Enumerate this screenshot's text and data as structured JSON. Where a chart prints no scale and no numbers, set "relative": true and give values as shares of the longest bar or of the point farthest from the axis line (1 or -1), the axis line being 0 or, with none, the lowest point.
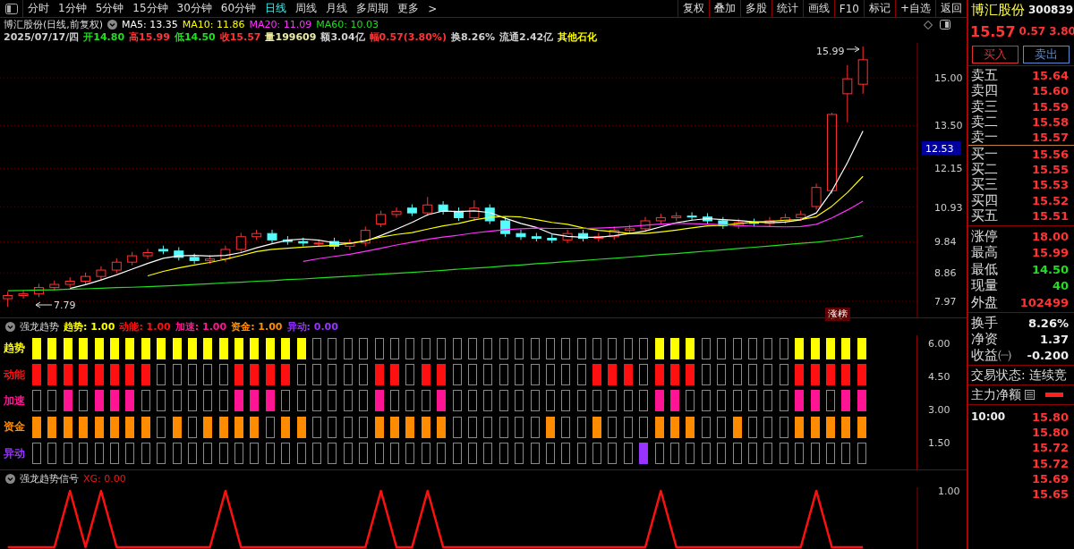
{
  "toolbar": {
    "tabs": [
      {
        "label": "分时",
        "selected": false
      },
      {
        "label": "1分钟",
        "selected": false
      },
      {
        "label": "5分钟",
        "selected": false
      },
      {
        "label": "15分钟",
        "selected": false
      },
      {
        "label": "30分钟",
        "selected": false
      },
      {
        "label": "60分钟",
        "selected": false
      },
      {
        "label": "日线",
        "selected": true
      },
      {
        "label": "周线",
        "selected": false
      },
      {
        "label": "月线",
        "selected": false
      },
      {
        "label": "多周期",
        "selected": false
      },
      {
        "label": "更多",
        "selected": false
      }
    ],
    "more_arrow": ">",
    "buttons": [
      "复权",
      "叠加",
      "多股",
      "统计",
      "画线",
      "F10",
      "标记",
      "+自选",
      "返回"
    ]
  },
  "chart_header": {
    "title": "博汇股份(日线,前复权)",
    "ma_readings": [
      ": 13.35",
      ": 11.86",
      ": 11.09",
      ": 10.03"
    ],
    "quote": [
      {
        "text": "2025/07/17/四",
        "color": "#d0d0d0"
      },
      {
        "text": "开14.80",
        "color": "#22dd22"
      },
      {
        "text": "高15.99",
        "color": "#ff3333"
      },
      {
        "text": "低14.50",
        "color": "#22dd22"
      },
      {
        "text": "收15.57",
        "color": "#ff3333"
      },
      {
        "text": "量199609",
        "color": "#e8e8a0"
      },
      {
        "text": "额3.04亿",
        "color": "#d0d0d0"
      },
      {
        "text": "幅0.57(3.80%)",
        "color": "#ff3333"
      },
      {
        "text": "换8.26%",
        "color": "#d0d0d0"
      },
      {
        "text": "流通2.42亿",
        "color": "#d0d0d0"
      },
      {
        "text": "其他石化",
        "color": "#ffff00"
      }
    ]
  },
  "main_chart": {
    "current_price": "12.53",
    "high_label": "15.99",
    "low_label": "7.79",
    "tag": "涨榜",
    "chart_data": {
      "type": "candlestick",
      "ylim": [
        7.46,
        16.1
      ],
      "grid": true,
      "ohlc": [
        [
          8.05,
          8.27,
          7.79,
          8.15
        ],
        [
          8.15,
          8.32,
          8.05,
          8.2
        ],
        [
          8.2,
          8.52,
          8.1,
          8.4
        ],
        [
          8.4,
          8.62,
          8.3,
          8.5
        ],
        [
          8.5,
          8.72,
          8.4,
          8.6
        ],
        [
          8.6,
          8.87,
          8.5,
          8.75
        ],
        [
          8.75,
          9.07,
          8.65,
          8.95
        ],
        [
          8.95,
          9.32,
          8.85,
          9.2
        ],
        [
          9.2,
          9.52,
          9.1,
          9.4
        ],
        [
          9.4,
          9.62,
          9.3,
          9.5
        ],
        [
          9.6,
          9.72,
          9.45,
          9.55
        ],
        [
          9.55,
          9.67,
          9.25,
          9.35
        ],
        [
          9.35,
          9.47,
          9.15,
          9.25
        ],
        [
          9.25,
          9.42,
          9.15,
          9.3
        ],
        [
          9.3,
          9.72,
          9.2,
          9.6
        ],
        [
          9.6,
          10.12,
          9.5,
          10.0
        ],
        [
          10.0,
          10.22,
          9.9,
          10.1
        ],
        [
          10.1,
          10.22,
          9.8,
          9.9
        ],
        [
          9.9,
          10.02,
          9.75,
          9.85
        ],
        [
          9.85,
          9.97,
          9.7,
          9.8
        ],
        [
          9.8,
          9.92,
          9.7,
          9.8
        ],
        [
          9.85,
          9.97,
          9.6,
          9.7
        ],
        [
          9.7,
          9.92,
          9.6,
          9.8
        ],
        [
          9.8,
          10.32,
          9.7,
          10.2
        ],
        [
          10.4,
          10.82,
          10.3,
          10.7
        ],
        [
          10.7,
          10.92,
          10.6,
          10.8
        ],
        [
          10.9,
          11.02,
          10.65,
          10.75
        ],
        [
          10.75,
          11.25,
          10.65,
          11.0
        ],
        [
          11.0,
          11.12,
          10.7,
          10.8
        ],
        [
          10.8,
          10.92,
          10.5,
          10.6
        ],
        [
          10.6,
          11.15,
          10.5,
          10.9
        ],
        [
          10.9,
          11.02,
          10.4,
          10.5
        ],
        [
          10.5,
          10.62,
          10.0,
          10.1
        ],
        [
          10.1,
          10.22,
          9.9,
          10.0
        ],
        [
          10.0,
          10.12,
          9.85,
          9.95
        ],
        [
          9.95,
          10.07,
          9.8,
          9.9
        ],
        [
          9.9,
          10.22,
          9.8,
          10.1
        ],
        [
          10.1,
          10.22,
          9.85,
          9.95
        ],
        [
          9.95,
          10.12,
          9.85,
          10.0
        ],
        [
          10.0,
          10.32,
          9.9,
          10.2
        ],
        [
          10.2,
          10.37,
          10.1,
          10.25
        ],
        [
          10.25,
          10.62,
          10.15,
          10.5
        ],
        [
          10.5,
          10.72,
          10.4,
          10.6
        ],
        [
          10.6,
          10.77,
          10.5,
          10.65
        ],
        [
          10.65,
          10.77,
          10.52,
          10.62
        ],
        [
          10.62,
          10.74,
          10.4,
          10.5
        ],
        [
          10.5,
          10.62,
          10.25,
          10.35
        ],
        [
          10.35,
          10.57,
          10.25,
          10.45
        ],
        [
          10.45,
          10.57,
          10.32,
          10.42
        ],
        [
          10.42,
          10.62,
          10.32,
          10.5
        ],
        [
          10.5,
          10.72,
          10.4,
          10.6
        ],
        [
          10.6,
          10.82,
          10.5,
          10.7
        ],
        [
          10.95,
          11.67,
          10.85,
          11.55
        ],
        [
          11.45,
          13.9,
          11.35,
          13.85
        ],
        [
          14.5,
          15.4,
          13.6,
          14.97
        ],
        [
          14.8,
          15.99,
          14.5,
          15.57
        ],
        null,
        null,
        null
      ],
      "categories": [
        null,
        null,
        null,
        null,
        null,
        null,
        null,
        null,
        null,
        null,
        null,
        null,
        null,
        null,
        null,
        null,
        null,
        null,
        null,
        null,
        null,
        null,
        null,
        null,
        null,
        null,
        null,
        null,
        null,
        null,
        null,
        null,
        null,
        null,
        null,
        null,
        null,
        null,
        null,
        null,
        null,
        null,
        null,
        null,
        null,
        null,
        null,
        null,
        null,
        null,
        null,
        null,
        null,
        null,
        null,
        null,
        null,
        null,
        null
      ],
      "yticks": [
        {
          "value": 15,
          "label": "15.00"
        },
        {
          "value": 13.5,
          "label": "13.50"
        },
        {
          "value": 12.15,
          "label": "12.15"
        },
        {
          "value": 10.93,
          "label": "10.93"
        },
        {
          "value": 9.84,
          "label": "9.84"
        },
        {
          "value": 8.86,
          "label": "8.86"
        },
        {
          "value": 7.97,
          "label": "7.97"
        }
      ],
      "series": [
        {
          "name": "MA5",
          "type": "line",
          "color": "#ffffff",
          "values": [
            null,
            null,
            null,
            null,
            8.37,
            8.49,
            8.64,
            8.8,
            8.98,
            9.16,
            9.32,
            9.4,
            9.41,
            9.39,
            9.41,
            9.5,
            9.65,
            9.78,
            9.89,
            9.93,
            9.89,
            9.81,
            9.79,
            9.86,
            10.04,
            10.24,
            10.45,
            10.69,
            10.81,
            10.79,
            10.81,
            10.76,
            10.58,
            10.42,
            10.29,
            10.09,
            10.01,
            9.98,
            9.98,
            10.03,
            10.1,
            10.18,
            10.31,
            10.44,
            10.52,
            10.57,
            10.54,
            10.51,
            10.47,
            10.44,
            10.46,
            10.53,
            10.75,
            11.44,
            12.33,
            13.33,
            null,
            null,
            null
          ]
        },
        {
          "name": "MA10",
          "type": "line",
          "color": "#ffff00",
          "values": [
            null,
            null,
            null,
            null,
            null,
            null,
            null,
            null,
            null,
            8.77,
            8.91,
            9.02,
            9.11,
            9.19,
            9.29,
            9.41,
            9.53,
            9.6,
            9.64,
            9.67,
            9.7,
            9.73,
            9.79,
            9.88,
            9.99,
            10.07,
            10.13,
            10.24,
            10.34,
            10.42,
            10.53,
            10.61,
            10.64,
            10.62,
            10.54,
            10.45,
            10.39,
            10.28,
            10.2,
            10.16,
            10.1,
            10.1,
            10.15,
            10.21,
            10.28,
            10.34,
            10.36,
            10.41,
            10.46,
            10.48,
            10.52,
            10.54,
            10.63,
            10.96,
            11.39,
            11.9,
            null,
            null,
            null
          ]
        },
        {
          "name": "MA20",
          "type": "line",
          "color": "#ff33ff",
          "values": [
            null,
            null,
            null,
            null,
            null,
            null,
            null,
            null,
            null,
            null,
            null,
            null,
            null,
            null,
            null,
            null,
            null,
            null,
            null,
            9.22,
            9.31,
            9.38,
            9.45,
            9.54,
            9.64,
            9.74,
            9.83,
            9.92,
            9.99,
            10.05,
            10.12,
            10.17,
            10.22,
            10.25,
            10.27,
            10.26,
            10.26,
            10.26,
            10.27,
            10.29,
            10.32,
            10.36,
            10.4,
            10.42,
            10.41,
            10.4,
            10.38,
            10.35,
            10.33,
            10.32,
            10.31,
            10.32,
            10.39,
            10.59,
            10.84,
            11.12,
            null,
            null,
            null
          ]
        },
        {
          "name": "MA60",
          "type": "line",
          "color": "#22dd22",
          "values": [
            8.3,
            8.31,
            8.32,
            8.33,
            8.35,
            8.36,
            8.38,
            8.4,
            8.41,
            8.43,
            8.45,
            8.47,
            8.5,
            8.52,
            8.55,
            8.57,
            8.6,
            8.62,
            8.65,
            8.67,
            8.7,
            8.73,
            8.76,
            8.79,
            8.82,
            8.85,
            8.88,
            8.91,
            8.94,
            8.98,
            9.01,
            9.04,
            9.08,
            9.11,
            9.15,
            9.18,
            9.22,
            9.25,
            9.29,
            9.32,
            9.36,
            9.4,
            9.44,
            9.47,
            9.51,
            9.55,
            9.59,
            9.63,
            9.67,
            9.71,
            9.75,
            9.79,
            9.83,
            9.88,
            9.95,
            10.03,
            null,
            null,
            null
          ]
        }
      ]
    }
  },
  "indicator": {
    "title": "强龙趋势",
    "values": [
      {
        "text": "趋势: 1.00",
        "color": "#ffff00"
      },
      {
        "text": "动能: 1.00",
        "color": "#ff1010"
      },
      {
        "text": "加速: 1.00",
        "color": "#ff1493"
      },
      {
        "text": "资金: 1.00",
        "color": "#ff8c00"
      },
      {
        "text": "异动: 0.00",
        "color": "#9933ff"
      }
    ],
    "yticks": [
      "6.00",
      "4.50",
      "3.00",
      "1.50"
    ],
    "rows": [
      {
        "label": "趋势",
        "color": "#ffff00",
        "cells": [
          true,
          true,
          true,
          true,
          true,
          true,
          true,
          true,
          true,
          true,
          true,
          true,
          true,
          true,
          true,
          true,
          true,
          true,
          false,
          false,
          false,
          false,
          false,
          false,
          false,
          false,
          false,
          false,
          false,
          false,
          false,
          false,
          false,
          false,
          false,
          false,
          false,
          false,
          false,
          false,
          true,
          true,
          true,
          false,
          false,
          false,
          false,
          false,
          false,
          true,
          true,
          true,
          true,
          true
        ]
      },
      {
        "label": "动能",
        "color": "#ff1010",
        "cells": [
          true,
          true,
          true,
          true,
          true,
          true,
          true,
          true,
          false,
          false,
          false,
          false,
          false,
          true,
          true,
          true,
          true,
          false,
          false,
          false,
          false,
          false,
          true,
          true,
          false,
          true,
          true,
          false,
          false,
          false,
          false,
          false,
          false,
          false,
          false,
          false,
          true,
          true,
          true,
          false,
          true,
          true,
          true,
          false,
          false,
          false,
          false,
          false,
          false,
          true,
          true,
          true,
          true,
          true
        ]
      },
      {
        "label": "加速",
        "color": "#ff1493",
        "cells": [
          false,
          false,
          true,
          false,
          true,
          true,
          true,
          false,
          false,
          false,
          false,
          false,
          false,
          true,
          true,
          true,
          false,
          false,
          false,
          false,
          false,
          false,
          true,
          false,
          false,
          false,
          true,
          false,
          false,
          false,
          false,
          false,
          false,
          false,
          false,
          false,
          false,
          false,
          false,
          false,
          true,
          true,
          false,
          false,
          false,
          false,
          false,
          false,
          false,
          true,
          true,
          false,
          true,
          true
        ]
      },
      {
        "label": "资金",
        "color": "#ff8c00",
        "cells": [
          true,
          true,
          true,
          true,
          true,
          true,
          true,
          true,
          false,
          true,
          false,
          true,
          true,
          true,
          true,
          false,
          true,
          true,
          false,
          false,
          false,
          false,
          true,
          true,
          true,
          true,
          true,
          false,
          false,
          false,
          false,
          false,
          false,
          true,
          false,
          false,
          true,
          false,
          false,
          false,
          true,
          true,
          true,
          false,
          false,
          true,
          false,
          false,
          false,
          true,
          true,
          true,
          true,
          true
        ]
      },
      {
        "label": "异动",
        "color": "#9933ff",
        "cells": [
          false,
          false,
          false,
          false,
          false,
          false,
          false,
          false,
          false,
          false,
          false,
          false,
          false,
          false,
          false,
          false,
          false,
          false,
          false,
          false,
          false,
          false,
          false,
          false,
          false,
          false,
          false,
          false,
          false,
          false,
          false,
          false,
          false,
          false,
          false,
          false,
          false,
          false,
          false,
          true,
          false,
          false,
          false,
          false,
          false,
          false,
          false,
          false,
          false,
          false,
          false,
          false,
          false,
          false
        ]
      }
    ]
  },
  "signal": {
    "title": "强龙趋势信号",
    "reading": ": 0.00",
    "chart_data": {
      "type": "line",
      "relative": true,
      "annotations": [
        {
          "text": "1.00"
        }
      ],
      "series": [
        {
          "name": "XG",
          "color": "#ff1010",
          "values": [
            0,
            0,
            0,
            0,
            1,
            0,
            1,
            0,
            0,
            0,
            0,
            0,
            0,
            0,
            1,
            0,
            0,
            0,
            0,
            0,
            0,
            0,
            0,
            0,
            1,
            0,
            0,
            1,
            0,
            0,
            0,
            0,
            0,
            0,
            0,
            0,
            0,
            0,
            0,
            0,
            0,
            0,
            1,
            0,
            0,
            0,
            0,
            0,
            0,
            0,
            0,
            0,
            1,
            0,
            0,
            0
          ]
        }
      ]
    }
  },
  "quote_panel": {
    "name": "博汇股份",
    "code": "300839",
    "price": "15.57",
    "change": "0.57",
    "percent": "3.80",
    "buy_button": "买入",
    "sell_button": "卖出",
    "asks": [
      {
        "label": "卖五",
        "price": "15.64"
      },
      {
        "label": "卖四",
        "price": "15.60"
      },
      {
        "label": "卖三",
        "price": "15.59"
      },
      {
        "label": "卖二",
        "price": "15.58"
      },
      {
        "label": "卖一",
        "price": "15.57"
      }
    ],
    "bids": [
      {
        "label": "买一",
        "price": "15.56"
      },
      {
        "label": "买二",
        "price": "15.55"
      },
      {
        "label": "买三",
        "price": "15.53"
      },
      {
        "label": "买四",
        "price": "15.52"
      },
      {
        "label": "买五",
        "price": "15.51"
      }
    ],
    "stats": [
      {
        "label": "涨停",
        "value": "18.00",
        "color": "#ff3333"
      },
      {
        "label": "最高",
        "value": "15.99",
        "color": "#ff3333"
      },
      {
        "label": "最低",
        "value": "14.50",
        "color": "#22dd22"
      },
      {
        "label": "现量",
        "value": "40",
        "color": "#22dd22"
      },
      {
        "label": "外盘",
        "value": "102499",
        "color": "#ff3333"
      }
    ],
    "finance": [
      {
        "label": "换手",
        "value": "8.26%"
      },
      {
        "label": "净资",
        "value": "1.37"
      },
      {
        "label": "收益㈠",
        "value": "-0.200"
      }
    ],
    "status": "交易状态: 连续竞",
    "flow_label": "主力净额",
    "ticks": [
      {
        "time": "10:00",
        "price": "15.80"
      },
      {
        "price": "15.80"
      },
      {
        "price": "15.72"
      },
      {
        "price": "15.72"
      },
      {
        "price": "15.69"
      },
      {
        "price": "15.65"
      }
    ]
  }
}
